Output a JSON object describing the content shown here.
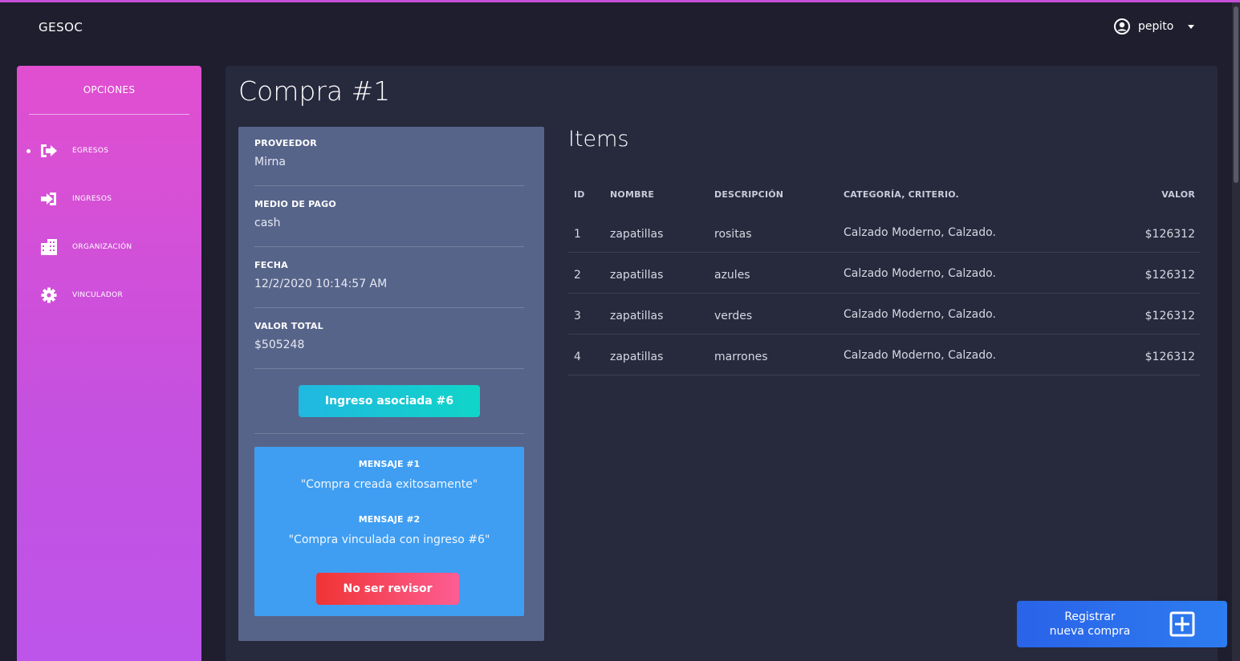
{
  "navbar": {
    "brand": "GESOC",
    "user_name": "pepito"
  },
  "sidebar": {
    "title": "OPCIONES",
    "items": [
      {
        "label": "EGRESOS",
        "icon": "sign-out-icon",
        "active": true
      },
      {
        "label": "INGRESOS",
        "icon": "sign-in-icon",
        "active": false
      },
      {
        "label": "ORGANIZACIÓN",
        "icon": "building-icon",
        "active": false
      },
      {
        "label": "VINCULADOR",
        "icon": "gear-icon",
        "active": false
      }
    ]
  },
  "page": {
    "title": "Compra #1"
  },
  "detail": {
    "proveedor_label": "PROVEEDOR",
    "proveedor_value": "Mirna",
    "medio_label": "MEDIO DE PAGO",
    "medio_value": "cash",
    "fecha_label": "FECHA",
    "fecha_value": "12/2/2020 10:14:57 AM",
    "total_label": "VALOR TOTAL",
    "total_value": "$505248",
    "ingreso_button": "Ingreso asociada #6"
  },
  "messages": {
    "items": [
      {
        "title": "MENSAJE #1",
        "text": "\"Compra creada exitosamente\""
      },
      {
        "title": "MENSAJE #2",
        "text": "\"Compra vinculada con ingreso #6\""
      }
    ],
    "revisor_button": "No ser revisor"
  },
  "items_section": {
    "title": "Items",
    "headers": {
      "id": "ID",
      "nombre": "NOMBRE",
      "descripcion": "DESCRIPCIÓN",
      "categoria": "CATEGORÍA, CRITERIO.",
      "valor": "VALOR"
    },
    "rows": [
      {
        "id": "1",
        "nombre": "zapatillas",
        "descripcion": "rositas",
        "categoria": "Calzado Moderno, Calzado.",
        "valor": "$126312"
      },
      {
        "id": "2",
        "nombre": "zapatillas",
        "descripcion": "azules",
        "categoria": "Calzado Moderno, Calzado.",
        "valor": "$126312"
      },
      {
        "id": "3",
        "nombre": "zapatillas",
        "descripcion": "verdes",
        "categoria": "Calzado Moderno, Calzado.",
        "valor": "$126312"
      },
      {
        "id": "4",
        "nombre": "zapatillas",
        "descripcion": "marrones",
        "categoria": "Calzado Moderno, Calzado.",
        "valor": "$126312"
      }
    ]
  },
  "fab": {
    "label_line1": "Registrar",
    "label_line2": "nueva compra",
    "icon": "plus-square-icon"
  },
  "colors": {
    "background": "#1e1e2e",
    "panel": "#27293d",
    "sidebar_top": "#e14fd0",
    "sidebar_bottom": "#bd55ea",
    "detail_card": "#57648a",
    "message_box": "#3f9ef2",
    "info_button": "#10d5c8",
    "danger_button": "#f03434",
    "primary_button": "#2a63e8"
  }
}
